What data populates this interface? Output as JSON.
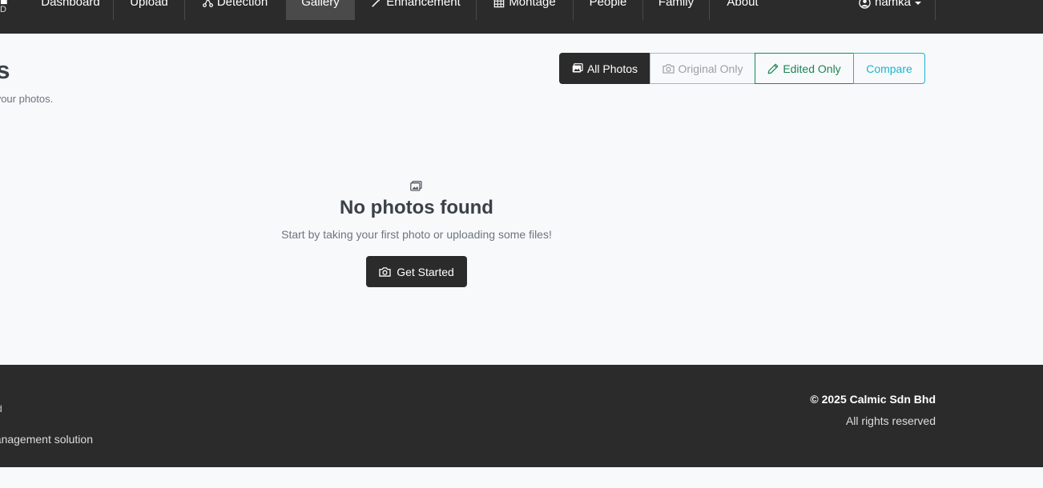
{
  "navbar": {
    "brand_mark": "■",
    "brand_sub": "D",
    "items": [
      {
        "label": "Dashboard"
      },
      {
        "label": "Upload"
      },
      {
        "label": "Detection",
        "icon": "diagram-icon"
      },
      {
        "label": "Gallery",
        "active": true
      },
      {
        "label": "Enhancement",
        "icon": "magic-wand-icon"
      },
      {
        "label": "Montage",
        "icon": "grid-icon"
      },
      {
        "label": "People"
      },
      {
        "label": "Family"
      },
      {
        "label": "About"
      }
    ],
    "user": {
      "label": "hamka",
      "icon": "user-circle-icon"
    }
  },
  "header": {
    "title": "tos",
    "subtitle": "ge all your photos."
  },
  "filters": {
    "all": "All Photos",
    "original": "Original Only",
    "edited": "Edited Only",
    "compare": "Compare"
  },
  "empty_state": {
    "icon": "image-icon",
    "title": "No photos found",
    "text": "Start by taking your first photo or uploading some files!",
    "button": "Get Started"
  },
  "footer": {
    "left_line1": "d",
    "left_line2": "nanagement solution",
    "copyright": "© 2025 Calmic Sdn Bhd",
    "rights": "All rights reserved"
  },
  "colors": {
    "nav_bg": "#2b2b2b",
    "success": "#198754",
    "info": "#17b6d0"
  }
}
